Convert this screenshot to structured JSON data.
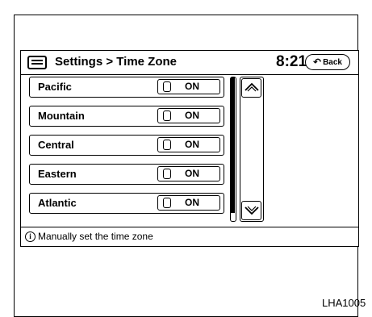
{
  "header": {
    "title": "Settings > Time Zone",
    "clock": "8:21",
    "back_label": "Back",
    "menu_icon": "menu-icon",
    "back_icon": "back-arrow-icon"
  },
  "rows": [
    {
      "label": "Pacific",
      "toggle": "ON"
    },
    {
      "label": "Mountain",
      "toggle": "ON"
    },
    {
      "label": "Central",
      "toggle": "ON"
    },
    {
      "label": "Eastern",
      "toggle": "ON"
    },
    {
      "label": "Atlantic",
      "toggle": "ON"
    }
  ],
  "scroll": {
    "up_icon": "chevron-up-icon",
    "down_icon": "chevron-down-icon",
    "thumb_start": 0.0,
    "thumb_end": 0.95
  },
  "info": {
    "icon": "info-icon",
    "text": "Manually set the time zone"
  },
  "caption": "LHA1005"
}
